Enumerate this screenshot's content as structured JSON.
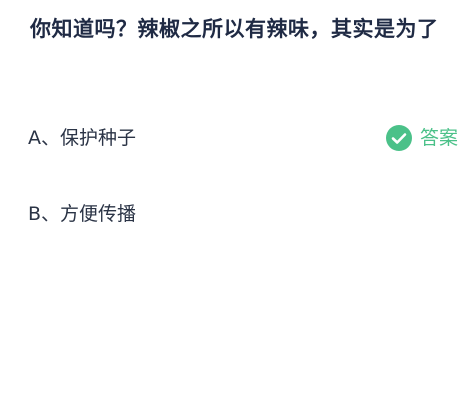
{
  "question": {
    "text": "你知道吗？辣椒之所以有辣味，其实是为了"
  },
  "options": [
    {
      "label": "A、保护种子",
      "is_answer": true
    },
    {
      "label": "B、方便传播",
      "is_answer": false
    }
  ],
  "answer_badge": {
    "label": "答案",
    "icon": "check-circle-icon",
    "color": "#4bc189"
  }
}
